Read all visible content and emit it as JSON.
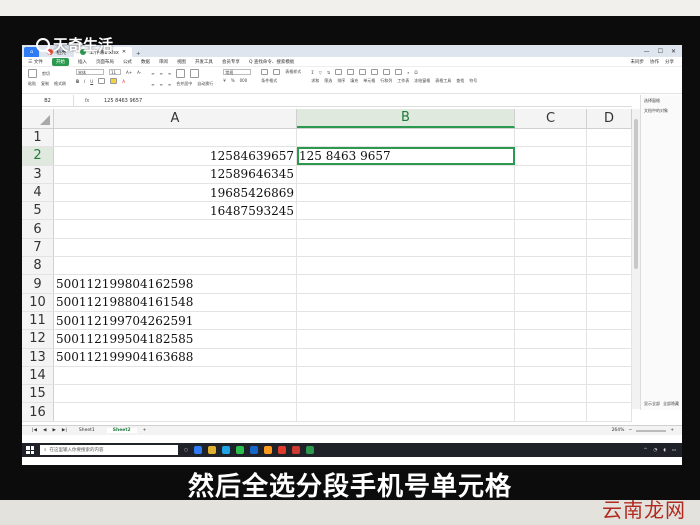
{
  "watermark": {
    "top": "天奇生活",
    "bottom": "云南龙网"
  },
  "caption": "然后全选分段手机号单元格",
  "titlebar": {
    "tabs": [
      {
        "label": "稻壳"
      },
      {
        "label": "工作簿1.xlsx"
      }
    ]
  },
  "menubar": {
    "items": [
      "三 文件",
      "开始",
      "插入",
      "页面布局",
      "公式",
      "数据",
      "审阅",
      "视图",
      "开发工具",
      "会员专享",
      "Q 查找命令、搜索模板"
    ],
    "right": [
      "未同步",
      "协作",
      "分享"
    ]
  },
  "ribbon": {
    "row1": [
      "粘贴",
      "剪切",
      "复制",
      "格式刷",
      "宋体",
      "11",
      "A+",
      "A-",
      "合并居中",
      "自动换行",
      "常规",
      "条件格式",
      "表格样式",
      "求和",
      "筛选",
      "排序",
      "填充",
      "单元格",
      "行和列",
      "工作表",
      "冻结窗格",
      "表格工具",
      "查找",
      "符号"
    ],
    "font_name": "宋体",
    "font_size": "11",
    "number_format": "常规"
  },
  "formula_bar": {
    "name_box": "B2",
    "fx": "fx",
    "content": "125 8463 9657"
  },
  "grid": {
    "columns": [
      "A",
      "B",
      "C",
      "D"
    ],
    "selected_column": "B",
    "rows": [
      {
        "n": "1",
        "a": "",
        "b": ""
      },
      {
        "n": "2",
        "a": "12584639657",
        "b": "125  8463  9657"
      },
      {
        "n": "3",
        "a": "12589646345",
        "b": ""
      },
      {
        "n": "4",
        "a": "19685426869",
        "b": ""
      },
      {
        "n": "5",
        "a": "16487593245",
        "b": ""
      },
      {
        "n": "6",
        "a": "",
        "b": ""
      },
      {
        "n": "7",
        "a": "",
        "b": ""
      },
      {
        "n": "8",
        "a": "",
        "b": ""
      },
      {
        "n": "9",
        "a": "500112199804162598",
        "b": ""
      },
      {
        "n": "10",
        "a": "500112198804161548",
        "b": ""
      },
      {
        "n": "11",
        "a": "500112199704262591",
        "b": ""
      },
      {
        "n": "12",
        "a": "500112199504182585",
        "b": ""
      },
      {
        "n": "13",
        "a": "500112199904163688",
        "b": ""
      },
      {
        "n": "14",
        "a": "",
        "b": ""
      },
      {
        "n": "15",
        "a": "",
        "b": ""
      },
      {
        "n": "16",
        "a": "",
        "b": ""
      }
    ]
  },
  "taskpane": {
    "title": "选择窗格",
    "subtitle": "文档中的对象",
    "footer_left": "显示全部",
    "footer_right": "全部隐藏"
  },
  "sheets": {
    "tabs": [
      "Sheet1",
      "Sheet2"
    ],
    "active": "Sheet2",
    "add": "+",
    "zoom": "264%"
  },
  "taskbar": {
    "search_placeholder": "在这里输入你要搜索的内容"
  },
  "colors": {
    "accent": "#2b9a4f",
    "selection_fill": "#dfe9dd",
    "taskbar": "#1f2228",
    "watermark": "#b22a1f"
  }
}
